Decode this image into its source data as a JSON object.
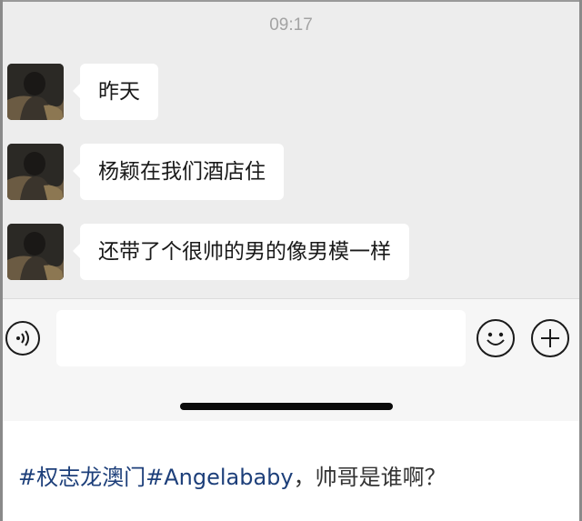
{
  "chat": {
    "timestamp": "09:17",
    "messages": [
      {
        "text": "昨天"
      },
      {
        "text": "杨颖在我们酒店住"
      },
      {
        "text": "还带了个很帅的男的像男模一样"
      }
    ]
  },
  "input_bar": {
    "icons": [
      "voice-icon",
      "emoji-icon",
      "plus-icon"
    ],
    "text_value": ""
  },
  "caption": {
    "hashtags": "#权志龙澳门#Angelababy",
    "text": "，帅哥是谁啊？"
  },
  "colors": {
    "chat_background": "#ededed",
    "bubble": "#ffffff",
    "hashtag": "#1d3f7a"
  }
}
